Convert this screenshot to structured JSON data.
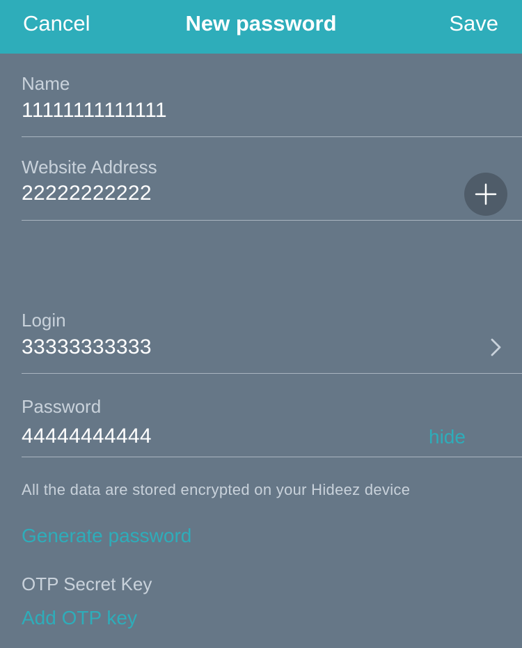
{
  "navbar": {
    "cancel_label": "Cancel",
    "title": "New password",
    "save_label": "Save"
  },
  "fields": {
    "name": {
      "label": "Name",
      "value": "11111111111111"
    },
    "website": {
      "label": "Website Address",
      "value": "22222222222"
    },
    "login": {
      "label": "Login",
      "value": "33333333333"
    },
    "password": {
      "label": "Password",
      "value": "44444444444",
      "toggle_label": "hide"
    }
  },
  "info_text": "All the data are stored encrypted on your Hideez device",
  "generate_password_label": "Generate password",
  "otp": {
    "label": "OTP Secret Key",
    "add_label": "Add OTP key"
  },
  "icons": {
    "add": "plus-icon",
    "disclosure": "chevron-right-icon"
  },
  "colors": {
    "accent": "#2eadba",
    "background": "#667787",
    "navbar": "#2eadba",
    "add_button": "#4f5c69"
  }
}
